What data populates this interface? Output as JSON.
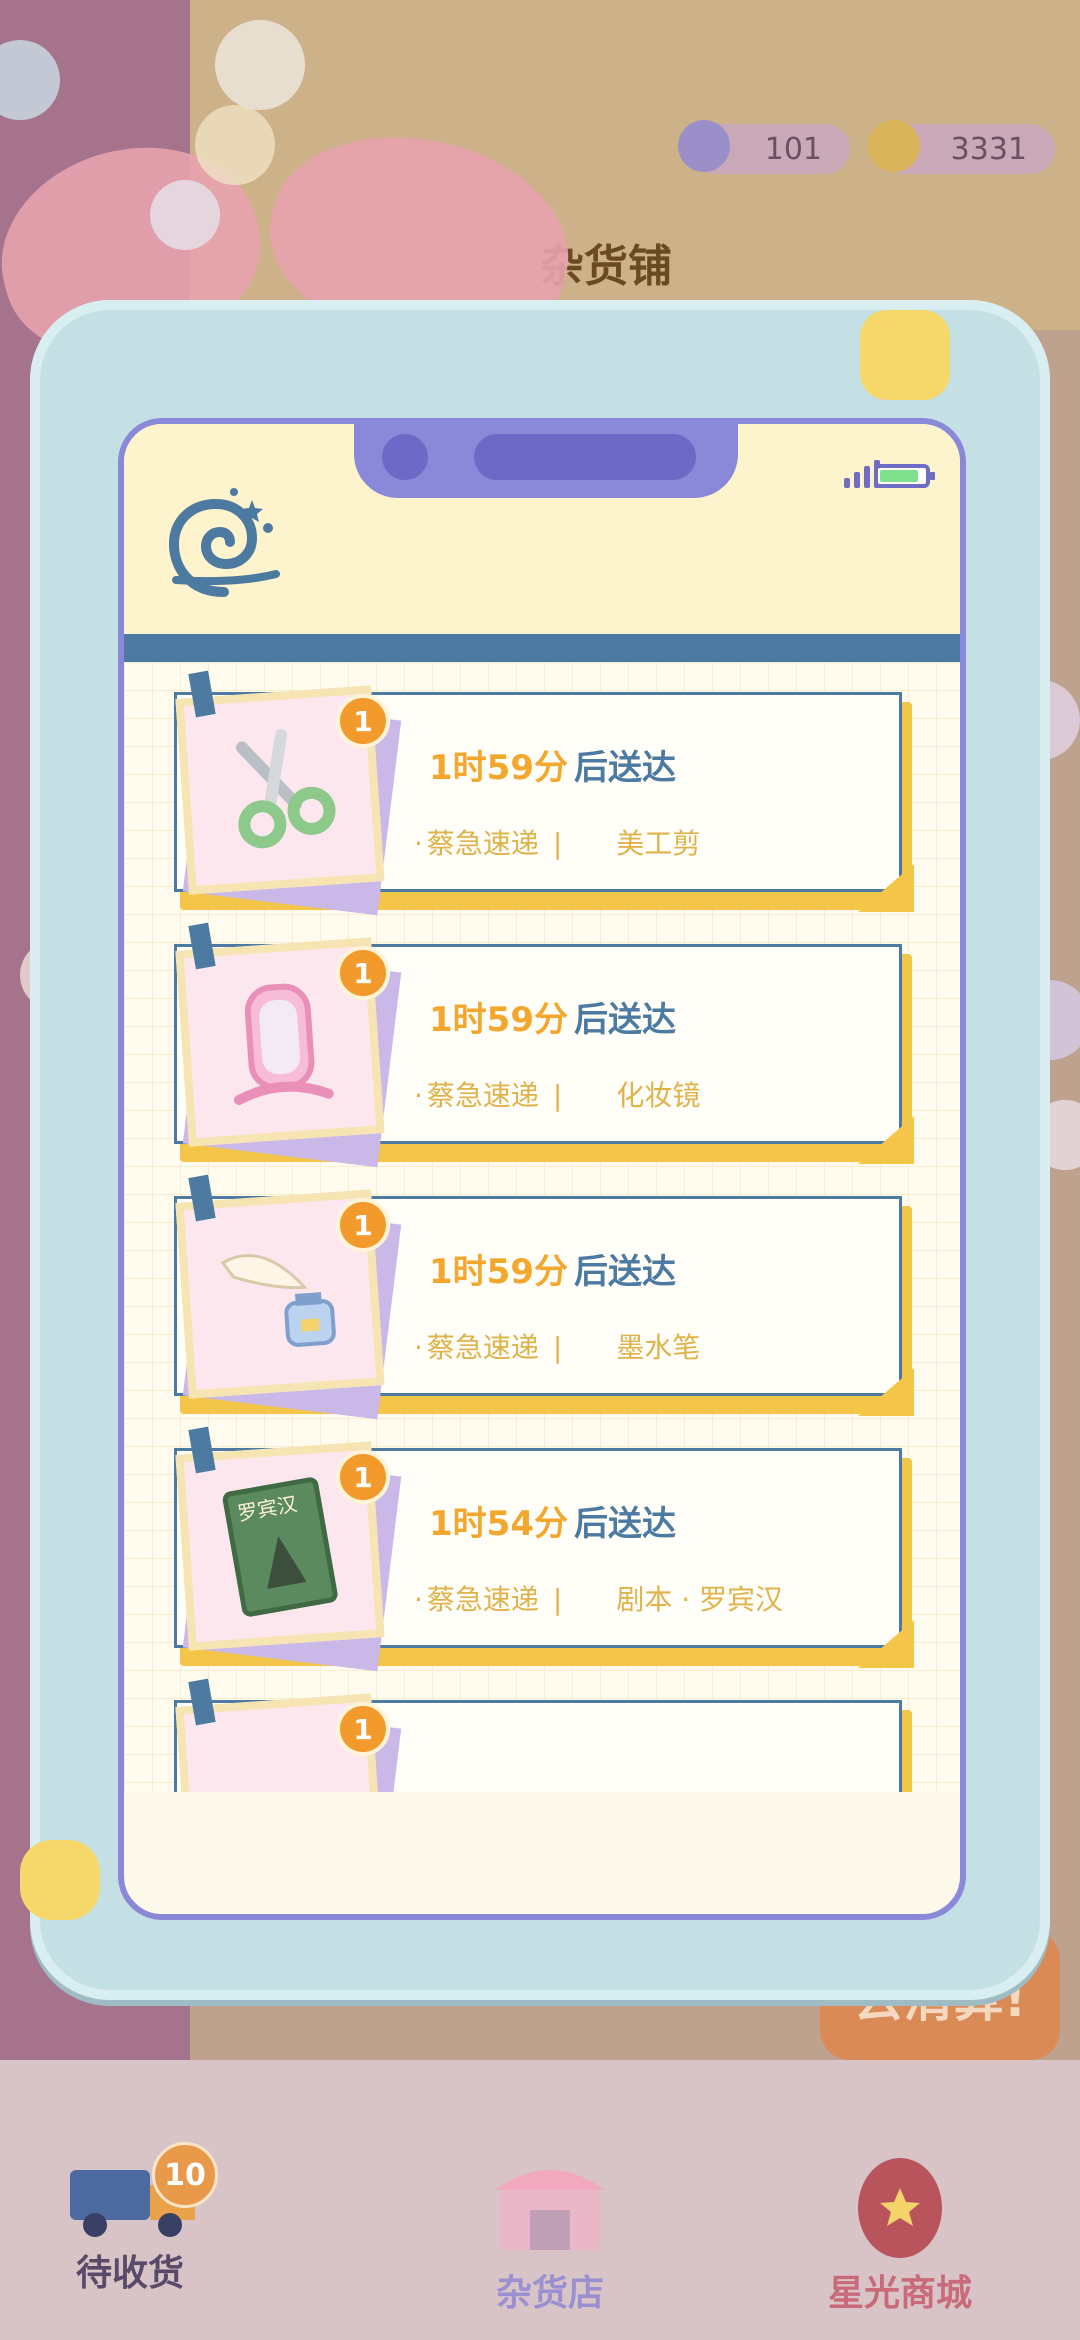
{
  "hud": {
    "stars": "101",
    "coins": "3331",
    "shop_title": "杂货铺"
  },
  "background_button": "去清算!",
  "phone": {
    "deliveries": [
      {
        "quantity": "1",
        "time": "1时59分",
        "suffix": "后送达",
        "courier": "蔡急速递",
        "separator": "|",
        "item": "美工剪",
        "icon": "scissors-icon"
      },
      {
        "quantity": "1",
        "time": "1时59分",
        "suffix": "后送达",
        "courier": "蔡急速递",
        "separator": "|",
        "item": "化妆镜",
        "icon": "vanity-mirror-icon"
      },
      {
        "quantity": "1",
        "time": "1时59分",
        "suffix": "后送达",
        "courier": "蔡急速递",
        "separator": "|",
        "item": "墨水笔",
        "icon": "quill-ink-icon"
      },
      {
        "quantity": "1",
        "time": "1时54分",
        "suffix": "后送达",
        "courier": "蔡急速递",
        "separator": "|",
        "item": "剧本 · 罗宾汉",
        "icon": "book-icon",
        "book_title": "罗宾汉"
      },
      {
        "quantity": "1"
      }
    ]
  },
  "bottom_nav": {
    "pending": {
      "label": "待收货",
      "badge": "10"
    },
    "shop": {
      "label": "杂货店"
    },
    "star_mall": {
      "label": "星光商城"
    }
  },
  "colors": {
    "frame": "#c5e0e4",
    "screen_border": "#8a88d8",
    "header_stripe": "#4d7aa0",
    "eta_time": "#f3a72d",
    "badge": "#f39a2d"
  }
}
